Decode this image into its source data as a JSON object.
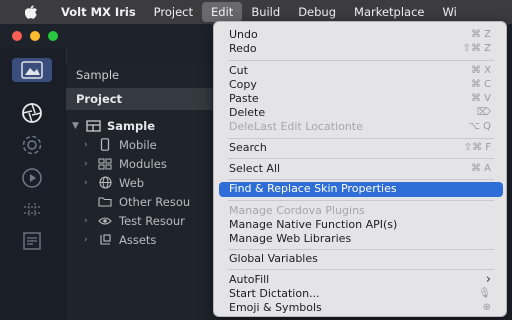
{
  "menubar": {
    "apple_icon": "apple-logo-icon",
    "items": [
      "Volt MX Iris",
      "Project",
      "Edit",
      "Build",
      "Debug",
      "Marketplace",
      "Wi"
    ],
    "active_index": 2
  },
  "sidebar": {
    "tab_title": "Sample",
    "project_header": "Project",
    "tree": [
      {
        "label": "Sample",
        "icon": "project-grid-icon"
      },
      {
        "label": "Mobile",
        "icon": "phone-icon"
      },
      {
        "label": "Modules",
        "icon": "modules-icon"
      },
      {
        "label": "Web",
        "icon": "globe-icon"
      },
      {
        "label": "Other Resou",
        "icon": "folder-icon"
      },
      {
        "label": "Test Resour",
        "icon": "eye-icon"
      },
      {
        "label": "Assets",
        "icon": "assets-icon"
      }
    ]
  },
  "tools": [
    "project-view-icon",
    "aperture-icon",
    "settings-icon",
    "play-icon",
    "grid-icon",
    "document-list-icon"
  ],
  "edit_menu": {
    "items": [
      {
        "label": "Undo",
        "shortcut": "⌘ Z"
      },
      {
        "label": "Redo",
        "shortcut": "⇧⌘ Z"
      },
      {
        "label": "Cut",
        "shortcut": "⌘ X"
      },
      {
        "label": "Copy",
        "shortcut": "⌘ C"
      },
      {
        "label": "Paste",
        "shortcut": "⌘ V"
      },
      {
        "label": "Delete",
        "shortcut": "⌦"
      },
      {
        "label": "DeleLast Edit Locationte",
        "shortcut": "⌥ Q"
      },
      {
        "label": "Search",
        "shortcut": "⇧⌘ F"
      },
      {
        "label": "Select All",
        "shortcut": "⌘ A"
      },
      {
        "label": "Find & Replace Skin Properties",
        "shortcut": ""
      },
      {
        "label": "Manage Cordova Plugins",
        "shortcut": ""
      },
      {
        "label": "Manage Native Function API(s)",
        "shortcut": ""
      },
      {
        "label": "Manage Web Libraries",
        "shortcut": ""
      },
      {
        "label": "Global Variables",
        "shortcut": ""
      },
      {
        "label": "AutoFill",
        "shortcut": "›"
      },
      {
        "label": "Start Dictation...",
        "shortcut": "🎙"
      },
      {
        "label": "Emoji & Symbols",
        "shortcut": "⊕"
      }
    ],
    "highlight_color": "#2f6ed6"
  }
}
